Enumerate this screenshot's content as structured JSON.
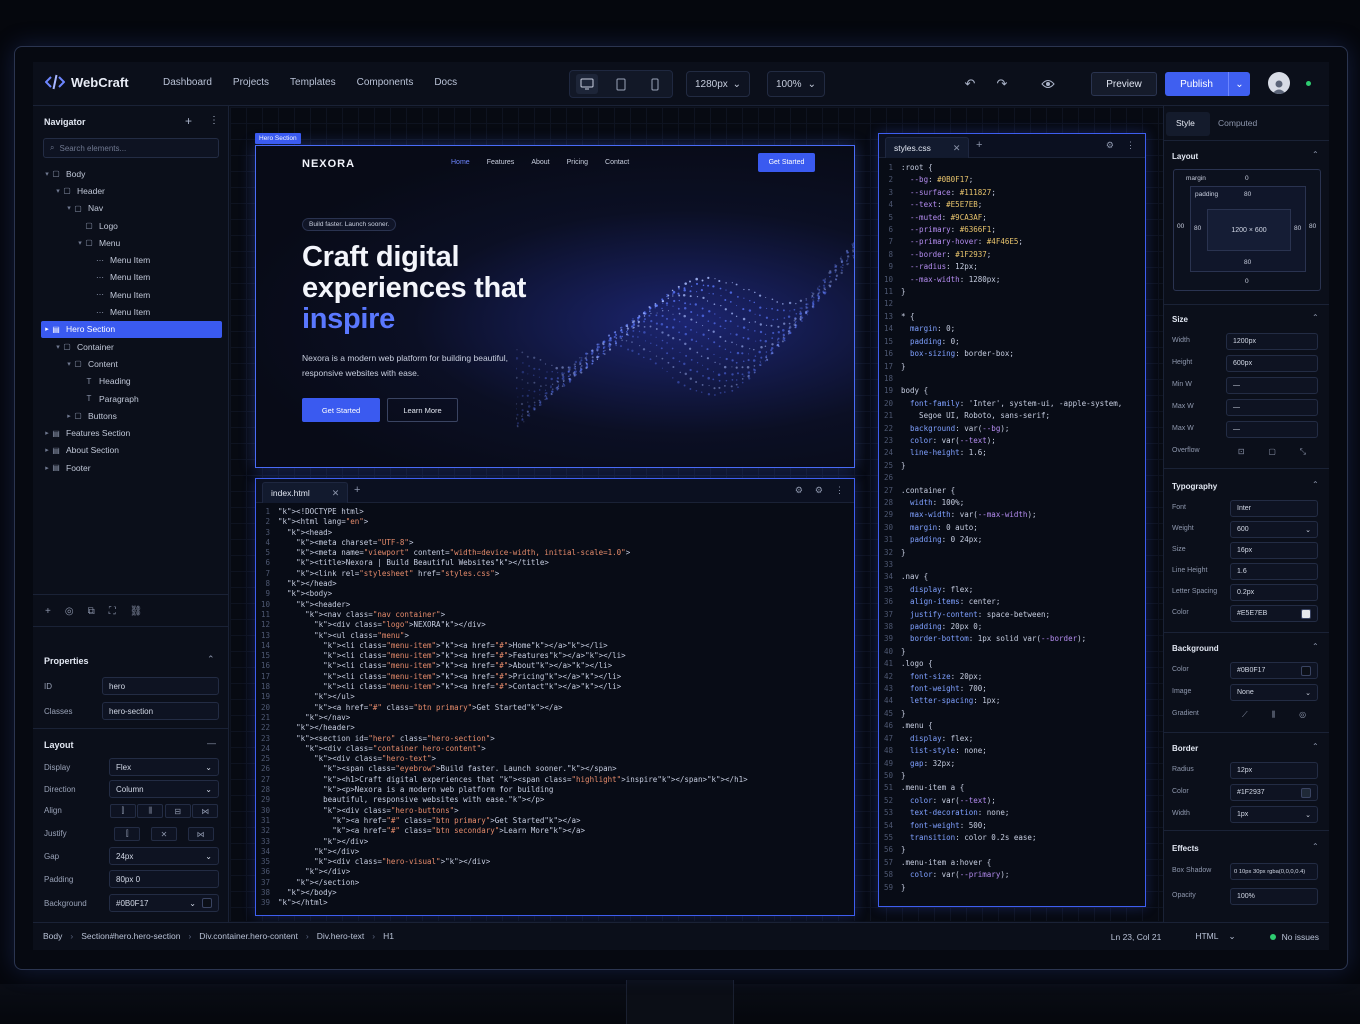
{
  "app": {
    "name": "WebCraft"
  },
  "topnav": [
    "Dashboard",
    "Projects",
    "Templates",
    "Components",
    "Docs"
  ],
  "toolbar": {
    "breakpoint": "1280px",
    "zoom": "100%",
    "preview_label": "Preview",
    "publish_label": "Publish"
  },
  "colors": {
    "accent": "#3F5FF0",
    "online": "#2ECC71",
    "bg": "#0A0E18"
  },
  "navigator": {
    "title": "Navigator",
    "search_placeholder": "Search elements...",
    "tree": [
      {
        "label": "Body",
        "depth": 0,
        "caret": "▾",
        "icon": "▢"
      },
      {
        "label": "Header",
        "depth": 1,
        "caret": "▾",
        "icon": "▢"
      },
      {
        "label": "Nav",
        "depth": 2,
        "caret": "▾",
        "icon": "▢"
      },
      {
        "label": "Logo",
        "depth": 3,
        "caret": "",
        "icon": "▢"
      },
      {
        "label": "Menu",
        "depth": 3,
        "caret": "▾",
        "icon": "▢"
      },
      {
        "label": "Menu Item",
        "depth": 4,
        "caret": "",
        "icon": "⋯"
      },
      {
        "label": "Menu Item",
        "depth": 4,
        "caret": "",
        "icon": "⋯"
      },
      {
        "label": "Menu Item",
        "depth": 4,
        "caret": "",
        "icon": "⋯"
      },
      {
        "label": "Menu Item",
        "depth": 4,
        "caret": "",
        "icon": "⋯"
      },
      {
        "label": "Hero Section",
        "depth": 0,
        "caret": "▸",
        "icon": "▤",
        "selected": true
      },
      {
        "label": "Container",
        "depth": 1,
        "caret": "▾",
        "icon": "▢"
      },
      {
        "label": "Content",
        "depth": 2,
        "caret": "▾",
        "icon": "▢"
      },
      {
        "label": "Heading",
        "depth": 3,
        "caret": "",
        "icon": "T"
      },
      {
        "label": "Paragraph",
        "depth": 3,
        "caret": "",
        "icon": "T"
      },
      {
        "label": "Buttons",
        "depth": 2,
        "caret": "▸",
        "icon": "▢"
      },
      {
        "label": "Features Section",
        "depth": 0,
        "caret": "▸",
        "icon": "▤"
      },
      {
        "label": "About Section",
        "depth": 0,
        "caret": "▸",
        "icon": "▤"
      },
      {
        "label": "Footer",
        "depth": 0,
        "caret": "▸",
        "icon": "▤"
      }
    ]
  },
  "properties": {
    "title": "Properties",
    "id_label": "ID",
    "id_value": "hero",
    "classes_label": "Classes",
    "classes_value": "hero-section"
  },
  "layout": {
    "title": "Layout",
    "display_label": "Display",
    "display_value": "Flex",
    "direction_label": "Direction",
    "direction_value": "Column",
    "align_label": "Align",
    "justify_label": "Justify",
    "gap_label": "Gap",
    "gap_value": "24px",
    "padding_label": "Padding",
    "padding_value": "80px 0",
    "background_label": "Background",
    "background_value": "#0B0F17"
  },
  "preview": {
    "tag": "Hero Section",
    "brand": "NEXORA",
    "nav": [
      "Home",
      "Features",
      "About",
      "Pricing",
      "Contact"
    ],
    "cta": "Get Started",
    "eyebrow": "Build faster. Launch sooner.",
    "heading_line1": "Craft digital",
    "heading_line2": "experiences that",
    "heading_highlight": "inspire",
    "paragraph": "Nexora is a modern web platform for building beautiful, responsive websites with ease.",
    "btn_primary": "Get Started",
    "btn_secondary": "Learn More"
  },
  "html_editor": {
    "tab": "index.html",
    "lines": [
      {
        "n": "1",
        "t": "<!DOCTYPE html>"
      },
      {
        "n": "2",
        "t": "<html lang=\"en\">"
      },
      {
        "n": "3",
        "t": "  <head>"
      },
      {
        "n": "4",
        "t": "    <meta charset=\"UTF-8\">"
      },
      {
        "n": "5",
        "t": "    <meta name=\"viewport\" content=\"width=device-width, initial-scale=1.0\">"
      },
      {
        "n": "6",
        "t": "    <title>Nexora | Build Beautiful Websites</title>"
      },
      {
        "n": "7",
        "t": "    <link rel=\"stylesheet\" href=\"styles.css\">"
      },
      {
        "n": "8",
        "t": "  </head>"
      },
      {
        "n": "9",
        "t": "  <body>"
      },
      {
        "n": "10",
        "t": "    <header>"
      },
      {
        "n": "11",
        "t": "      <nav class=\"nav container\">"
      },
      {
        "n": "12",
        "t": "        <div class=\"logo\">NEXORA</div>"
      },
      {
        "n": "13",
        "t": "        <ul class=\"menu\">"
      },
      {
        "n": "14",
        "t": "          <li class=\"menu-item\"><a href=\"#\">Home</a></li>"
      },
      {
        "n": "15",
        "t": "          <li class=\"menu-item\"><a href=\"#\">Features</a></li>"
      },
      {
        "n": "16",
        "t": "          <li class=\"menu-item\"><a href=\"#\">About</a></li>"
      },
      {
        "n": "17",
        "t": "          <li class=\"menu-item\"><a href=\"#\">Pricing</a></li>"
      },
      {
        "n": "18",
        "t": "          <li class=\"menu-item\"><a href=\"#\">Contact</a></li>"
      },
      {
        "n": "19",
        "t": "        </ul>"
      },
      {
        "n": "20",
        "t": "        <a href=\"#\" class=\"btn primary\">Get Started</a>"
      },
      {
        "n": "21",
        "t": "      </nav>"
      },
      {
        "n": "22",
        "t": "    </header>"
      },
      {
        "n": "23",
        "t": "    <section id=\"hero\" class=\"hero-section\">"
      },
      {
        "n": "24",
        "t": "      <div class=\"container hero-content\">"
      },
      {
        "n": "25",
        "t": "        <div class=\"hero-text\">"
      },
      {
        "n": "26",
        "t": "          <span class=\"eyebrow\">Build faster. Launch sooner.</span>"
      },
      {
        "n": "27",
        "t": "          <h1>Craft digital experiences that <span class=\"highlight\">inspire</span></h1>"
      },
      {
        "n": "28",
        "t": "          <p>Nexora is a modern web platform for building"
      },
      {
        "n": "29",
        "t": "          beautiful, responsive websites with ease.</p>"
      },
      {
        "n": "30",
        "t": "          <div class=\"hero-buttons\">"
      },
      {
        "n": "31",
        "t": "            <a href=\"#\" class=\"btn primary\">Get Started</a>"
      },
      {
        "n": "32",
        "t": "            <a href=\"#\" class=\"btn secondary\">Learn More</a>"
      },
      {
        "n": "33",
        "t": "          </div>"
      },
      {
        "n": "34",
        "t": "        </div>"
      },
      {
        "n": "35",
        "t": "        <div class=\"hero-visual\"></div>"
      },
      {
        "n": "36",
        "t": "      </div>"
      },
      {
        "n": "37",
        "t": "    </section>"
      },
      {
        "n": "38",
        "t": "  </body>"
      },
      {
        "n": "39",
        "t": "</html>"
      }
    ]
  },
  "css_editor": {
    "tab": "styles.css",
    "lines": [
      {
        "n": "1",
        "t": ":root {"
      },
      {
        "n": "2",
        "t": "  --bg: #0B0F17;"
      },
      {
        "n": "3",
        "t": "  --surface: #111827;"
      },
      {
        "n": "4",
        "t": "  --text: #E5E7EB;"
      },
      {
        "n": "5",
        "t": "  --muted: #9CA3AF;"
      },
      {
        "n": "6",
        "t": "  --primary: #6366F1;"
      },
      {
        "n": "7",
        "t": "  --primary-hover: #4F46E5;"
      },
      {
        "n": "8",
        "t": "  --border: #1F2937;"
      },
      {
        "n": "9",
        "t": "  --radius: 12px;"
      },
      {
        "n": "10",
        "t": "  --max-width: 1280px;"
      },
      {
        "n": "11",
        "t": "}"
      },
      {
        "n": "12",
        "t": ""
      },
      {
        "n": "13",
        "t": "* {"
      },
      {
        "n": "14",
        "t": "  margin: 0;"
      },
      {
        "n": "15",
        "t": "  padding: 0;"
      },
      {
        "n": "16",
        "t": "  box-sizing: border-box;"
      },
      {
        "n": "17",
        "t": "}"
      },
      {
        "n": "18",
        "t": ""
      },
      {
        "n": "19",
        "t": "body {"
      },
      {
        "n": "20",
        "t": "  font-family: 'Inter', system-ui, -apple-system,"
      },
      {
        "n": "21",
        "t": "    Segoe UI, Roboto, sans-serif;"
      },
      {
        "n": "22",
        "t": "  background: var(--bg);"
      },
      {
        "n": "23",
        "t": "  color: var(--text);"
      },
      {
        "n": "24",
        "t": "  line-height: 1.6;"
      },
      {
        "n": "25",
        "t": "}"
      },
      {
        "n": "26",
        "t": ""
      },
      {
        "n": "27",
        "t": ".container {"
      },
      {
        "n": "28",
        "t": "  width: 100%;"
      },
      {
        "n": "29",
        "t": "  max-width: var(--max-width);"
      },
      {
        "n": "30",
        "t": "  margin: 0 auto;"
      },
      {
        "n": "31",
        "t": "  padding: 0 24px;"
      },
      {
        "n": "32",
        "t": "}"
      },
      {
        "n": "33",
        "t": ""
      },
      {
        "n": "34",
        "t": ".nav {"
      },
      {
        "n": "35",
        "t": "  display: flex;"
      },
      {
        "n": "36",
        "t": "  align-items: center;"
      },
      {
        "n": "37",
        "t": "  justify-content: space-between;"
      },
      {
        "n": "38",
        "t": "  padding: 20px 0;"
      },
      {
        "n": "39",
        "t": "  border-bottom: 1px solid var(--border);"
      },
      {
        "n": "40",
        "t": "}"
      },
      {
        "n": "41",
        "t": ".logo {"
      },
      {
        "n": "42",
        "t": "  font-size: 20px;"
      },
      {
        "n": "43",
        "t": "  font-weight: 700;"
      },
      {
        "n": "44",
        "t": "  letter-spacing: 1px;"
      },
      {
        "n": "45",
        "t": "}"
      },
      {
        "n": "46",
        "t": ".menu {"
      },
      {
        "n": "47",
        "t": "  display: flex;"
      },
      {
        "n": "48",
        "t": "  list-style: none;"
      },
      {
        "n": "49",
        "t": "  gap: 32px;"
      },
      {
        "n": "50",
        "t": "}"
      },
      {
        "n": "51",
        "t": ".menu-item a {"
      },
      {
        "n": "52",
        "t": "  color: var(--text);"
      },
      {
        "n": "53",
        "t": "  text-decoration: none;"
      },
      {
        "n": "54",
        "t": "  font-weight: 500;"
      },
      {
        "n": "55",
        "t": "  transition: color 0.2s ease;"
      },
      {
        "n": "56",
        "t": "}"
      },
      {
        "n": "57",
        "t": ".menu-item a:hover {"
      },
      {
        "n": "58",
        "t": "  color: var(--primary);"
      },
      {
        "n": "59",
        "t": "}"
      }
    ]
  },
  "right_panel": {
    "tabs": [
      "Style",
      "Computed"
    ],
    "layout_title": "Layout",
    "box": {
      "margin_label": "margin",
      "padding_label": "padding",
      "size": "1200 × 600",
      "margin_top": "0",
      "margin_bottom": "0",
      "margin_left": "00",
      "margin_right": "80",
      "padding_top": "80",
      "padding_bottom": "80",
      "padding_left": "80",
      "padding_right": "80"
    },
    "size_title": "Size",
    "width_label": "Width",
    "width_value": "1200px",
    "height_label": "Height",
    "height_value": "600px",
    "minw_label": "Min W",
    "minw_value": "—",
    "maxw_label": "Max W",
    "maxw_value": "—",
    "maxh_label": "Max W",
    "maxh_value": "—",
    "overflow_label": "Overflow",
    "typo_title": "Typography",
    "font_label": "Font",
    "font_value": "Inter",
    "weight_label": "Weight",
    "weight_value": "600",
    "size_label": "Size",
    "size_value": "16px",
    "lh_label": "Line Height",
    "lh_value": "1.6",
    "ls_label": "Letter Spacing",
    "ls_value": "0.2px",
    "color_label": "Color",
    "color_value": "#E5E7EB",
    "bg_title": "Background",
    "bgcolor_label": "Color",
    "bgcolor_value": "#0B0F17",
    "image_label": "Image",
    "image_value": "None",
    "gradient_label": "Gradient",
    "border_title": "Border",
    "radius_label": "Radius",
    "radius_value": "12px",
    "bcolor_label": "Color",
    "bcolor_value": "#1F2937",
    "bwidth_label": "Width",
    "bwidth_value": "1px",
    "effects_title": "Effects",
    "shadow_label": "Box Shadow",
    "shadow_value": "0 10px 30px rgba(0,0,0,0.4)",
    "opacity_label": "Opacity",
    "opacity_value": "100%"
  },
  "statusbar": {
    "crumbs": [
      "Body",
      "Section#hero.hero-section",
      "Div.container.hero-content",
      "Div.hero-text",
      "H1"
    ],
    "cursor": "Ln 23, Col 21",
    "language": "HTML",
    "issues": "No issues"
  }
}
